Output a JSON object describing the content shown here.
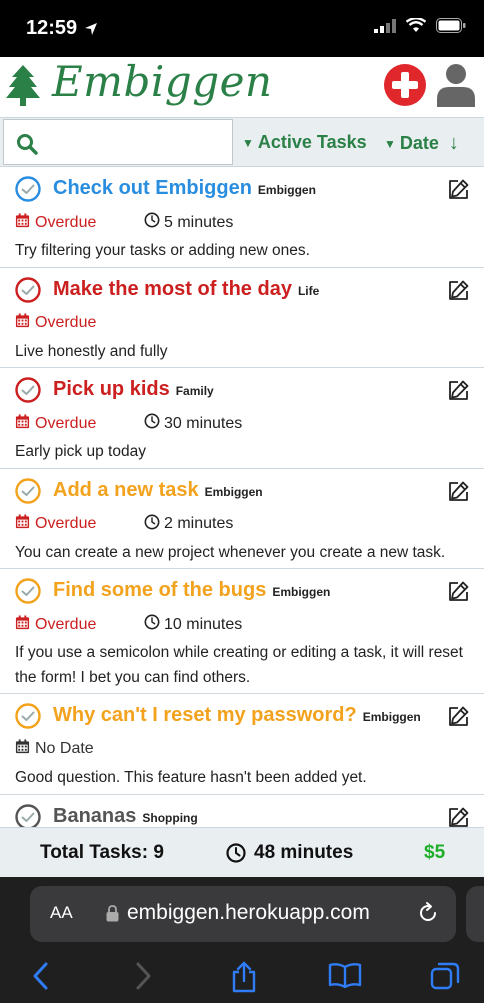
{
  "status": {
    "time": "12:59"
  },
  "app": {
    "name": "Embiggen"
  },
  "toolbar": {
    "search_placeholder": "",
    "filter_label": "Active Tasks",
    "sort_label": "Date",
    "sort_direction_glyph": "↓"
  },
  "tasks": [
    {
      "title": "Check out Embiggen",
      "project": "Embiggen",
      "due": "Overdue",
      "duration": "5 minutes",
      "description": "Try filtering your tasks or adding new ones.",
      "color": "#2a8ee0"
    },
    {
      "title": "Make the most of the day",
      "project": "Life",
      "due": "Overdue",
      "duration": "",
      "description": "Live honestly and fully",
      "color": "#cc1f1f"
    },
    {
      "title": "Pick up kids",
      "project": "Family",
      "due": "Overdue",
      "duration": "30 minutes",
      "description": "Early pick up today",
      "color": "#cc1f1f"
    },
    {
      "title": "Add a new task",
      "project": "Embiggen",
      "due": "Overdue",
      "duration": "2 minutes",
      "description": "You can create a new project whenever you create a new task.",
      "color": "#f3a21d"
    },
    {
      "title": "Find some of the bugs",
      "project": "Embiggen",
      "due": "Overdue",
      "duration": "10 minutes",
      "description": "If you use a semicolon while creating or editing a task, it will reset the form! I bet you can find others.",
      "color": "#f3a21d"
    },
    {
      "title": "Why can't I reset my password?",
      "project": "Embiggen",
      "due": "No Date",
      "duration": "",
      "description": "Good question. This feature hasn't been added yet.",
      "color": "#f3a21d"
    },
    {
      "title": "Bananas",
      "project": "Shopping",
      "due": "",
      "duration": "",
      "description": "",
      "color": "#555555"
    }
  ],
  "footer": {
    "total": "Total Tasks: 9",
    "time": "48 minutes",
    "cost": "$5"
  },
  "browser": {
    "aa": "AA",
    "url": "embiggen.herokuapp.com"
  },
  "colors": {
    "brand_green": "#2a8046",
    "overdue_red": "#cc1f1f",
    "cost_green": "#1fae2a",
    "browser_blue": "#2f7cf6"
  }
}
